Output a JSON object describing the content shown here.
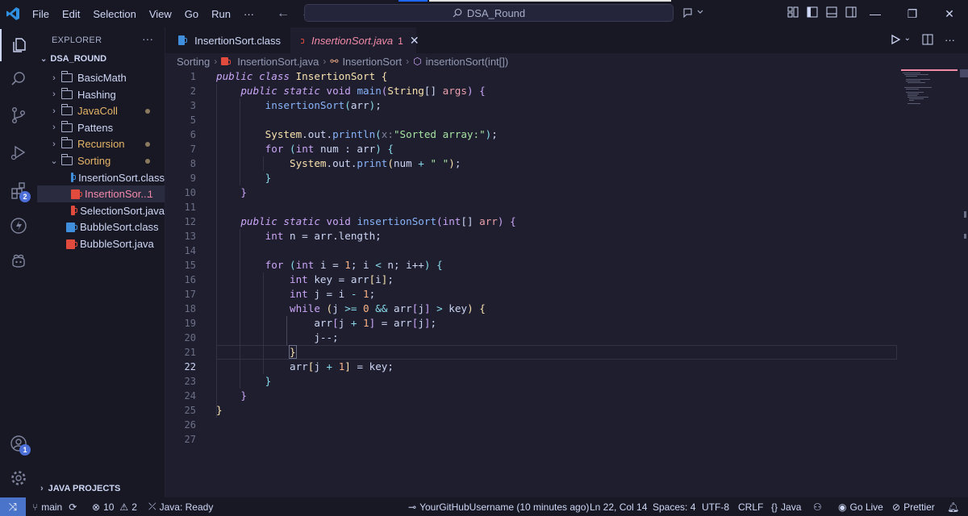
{
  "titlebar": {
    "menu": [
      "File",
      "Edit",
      "Selection",
      "View",
      "Go",
      "Run"
    ],
    "more": "···",
    "search": "DSA_Round"
  },
  "activity": {
    "extensions_badge": "2",
    "accounts_badge": "1"
  },
  "sidebar": {
    "header": "EXPLORER",
    "header_more": "···",
    "root": "DSA_ROUND",
    "items": [
      {
        "label": "BasicMath",
        "kind": "folder",
        "open": false,
        "color": "#cdd6f4"
      },
      {
        "label": "Hashing",
        "kind": "folder",
        "open": false,
        "color": "#cdd6f4"
      },
      {
        "label": "JavaColl",
        "kind": "folder",
        "open": false,
        "color": "#e5b567",
        "dot": true
      },
      {
        "label": "Pattens",
        "kind": "folder",
        "open": false,
        "color": "#cdd6f4"
      },
      {
        "label": "Recursion",
        "kind": "folder",
        "open": false,
        "color": "#e5b567",
        "dot": true
      },
      {
        "label": "Sorting",
        "kind": "folder",
        "open": true,
        "color": "#e5b567",
        "dot": true
      },
      {
        "label": "InsertionSort.class",
        "kind": "file-blue",
        "color": "#cdd6f4"
      },
      {
        "label": "InsertionSor...",
        "kind": "file-red",
        "color": "#f38ba8",
        "count": "1",
        "selected": true
      },
      {
        "label": "SelectionSort.java",
        "kind": "file-red",
        "color": "#cdd6f4"
      },
      {
        "label": "BubbleSort.class",
        "kind": "file-blue",
        "color": "#cdd6f4"
      },
      {
        "label": "BubbleSort.java",
        "kind": "file-red",
        "color": "#cdd6f4"
      }
    ],
    "java_projects": "JAVA PROJECTS"
  },
  "tabs": [
    {
      "label": "InsertionSort.class",
      "active": false
    },
    {
      "label": "InsertionSort.java",
      "active": true,
      "count": "1",
      "close": "✕"
    }
  ],
  "breadcrumb": [
    "Sorting",
    "InsertionSort.java",
    "InsertionSort",
    "insertionSort(int[])"
  ],
  "editor": {
    "current_line": 22,
    "line_numbers": [
      "1",
      "2",
      "3",
      "5",
      "6",
      "7",
      "8",
      "9",
      "10",
      "11",
      "12",
      "13",
      "14",
      "15",
      "16",
      "17",
      "18",
      "19",
      "20",
      "21",
      "22",
      "23",
      "24",
      "25",
      "26",
      "27"
    ]
  },
  "statusbar": {
    "branch": "main",
    "errors": "10",
    "warnings": "2",
    "java": "Java: Ready",
    "blame": "YourGitHubUsername (10 minutes ago)",
    "position": "Ln 22, Col 14",
    "spaces": "Spaces: 4",
    "encoding": "UTF-8",
    "eol": "CRLF",
    "language": "Java",
    "golive": "Go Live",
    "prettier": "Prettier"
  },
  "colors": {
    "accent": "#4a74c9",
    "error": "#f38ba8",
    "modified": "#e5b567"
  }
}
